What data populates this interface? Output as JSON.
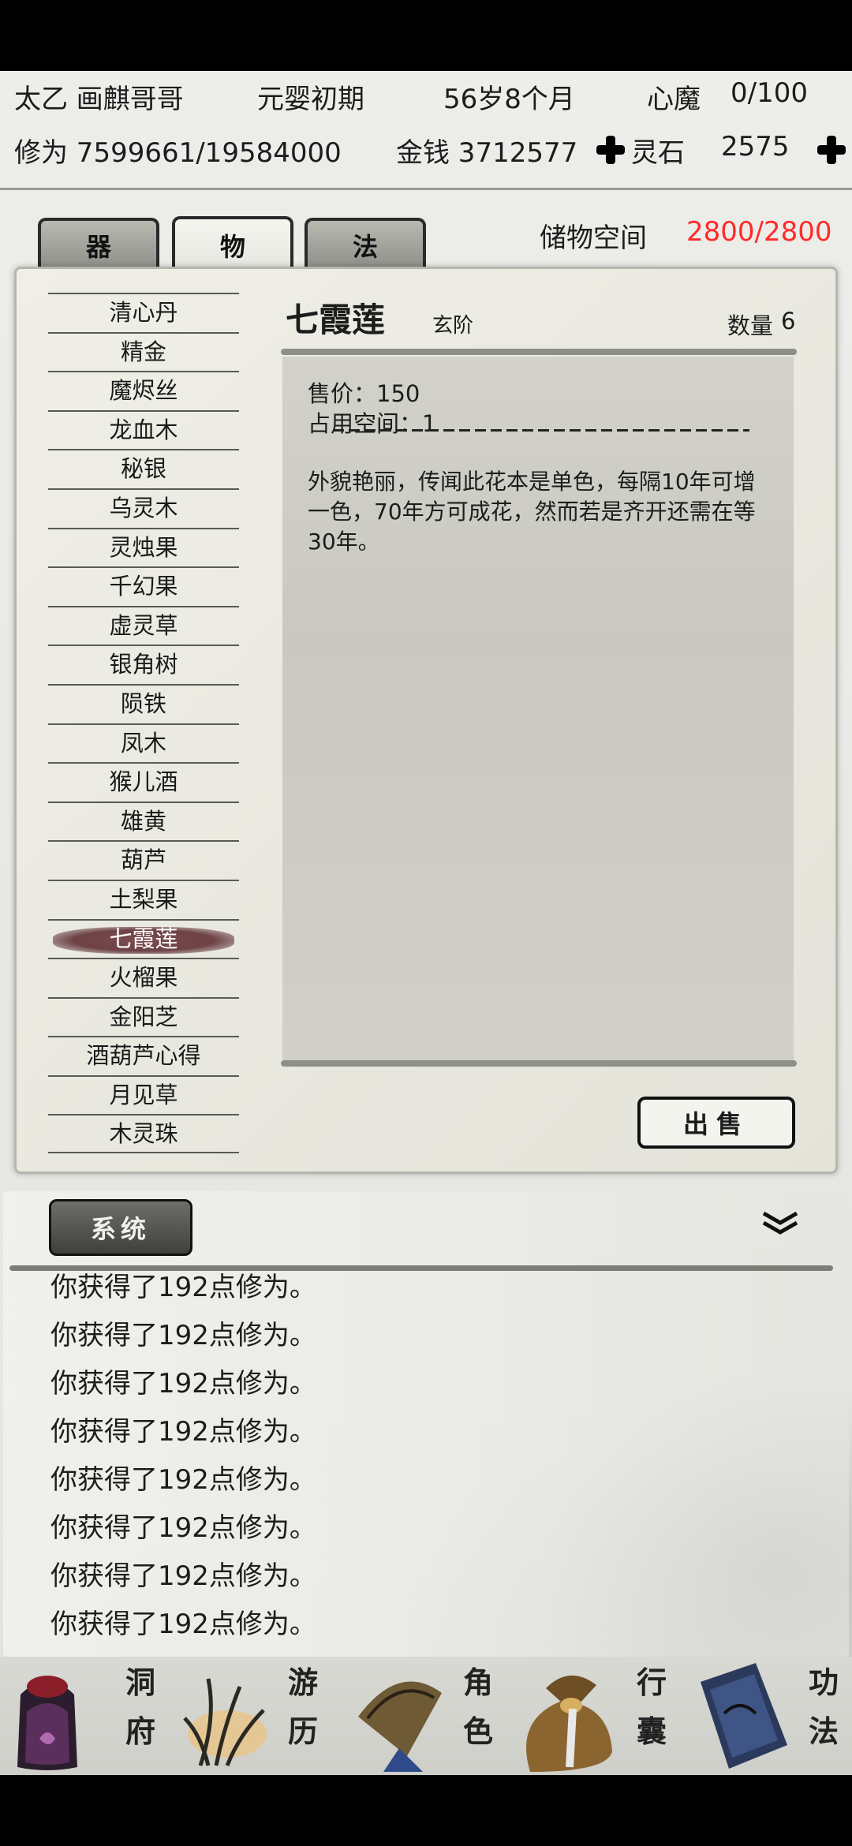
{
  "status": {
    "name": "太乙 画麒哥哥",
    "realm": "元婴初期",
    "age": "56岁8个月",
    "heart_demon_label": "心魔",
    "heart_demon_value": "0/100",
    "cultivation": "修为 7599661/19584000",
    "money": "金钱 3712577",
    "spirit_stone_label": "灵石",
    "spirit_stone_value": "2575"
  },
  "tabs": [
    {
      "label": "器",
      "active": false
    },
    {
      "label": "物",
      "active": true
    },
    {
      "label": "法",
      "active": false
    }
  ],
  "storage": {
    "label": "储物空间",
    "value": "2800/2800",
    "color": "#ff2a2a"
  },
  "items": [
    "清心丹",
    "精金",
    "魔烬丝",
    "龙血木",
    "秘银",
    "乌灵木",
    "灵烛果",
    "千幻果",
    "虚灵草",
    "银角树",
    "陨铁",
    "凤木",
    "猴儿酒",
    "雄黄",
    "葫芦",
    "土梨果",
    "七霞莲",
    "火榴果",
    "金阳芝",
    "酒葫芦心得",
    "月见草",
    "木灵珠"
  ],
  "selected_index": 16,
  "detail": {
    "name": "七霞莲",
    "rank": "玄阶",
    "qty_label": "数量",
    "qty_value": "6",
    "price": "售价：150",
    "space": "占用空间：1",
    "description": "外貌艳丽，传闻此花本是单色，每隔10年可增一色，70年方可成花，然而若是齐开还需在等30年。"
  },
  "sell_label": "出售",
  "log": {
    "tab_label": "系统",
    "lines": [
      "你获得了192点修为。",
      "你获得了192点修为。",
      "你获得了192点修为。",
      "你获得了192点修为。",
      "你获得了192点修为。",
      "你获得了192点修为。",
      "你获得了192点修为。",
      "你获得了192点修为。"
    ]
  },
  "nav": [
    {
      "label": "洞府",
      "icon": "cave-dwelling-icon"
    },
    {
      "label": "游历",
      "icon": "travel-grass-icon"
    },
    {
      "label": "角色",
      "icon": "character-hat-icon"
    },
    {
      "label": "行囊",
      "icon": "bag-icon"
    },
    {
      "label": "功法",
      "icon": "scroll-book-icon"
    }
  ]
}
